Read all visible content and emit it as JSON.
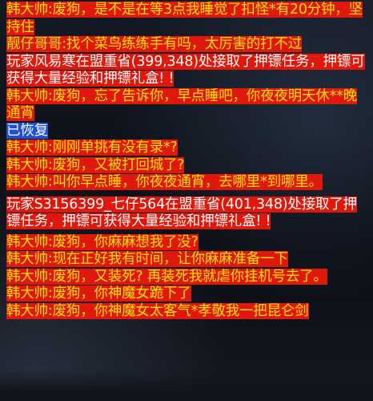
{
  "chat": {
    "messages": [
      {
        "kind": "npc",
        "text": "韩大帅:废狗，是不是在等3点我睡觉了扣怪*有20分钟，坚持住"
      },
      {
        "kind": "npc",
        "text": "靓仔哥哥:找个菜鸟练练手有吗，太厉害的打不过"
      },
      {
        "kind": "system",
        "text": "玩家风易寒在盟重省(399,348)处接取了押镖任务，押镖可获得大量经验和押镖礼盒! !"
      },
      {
        "kind": "npc",
        "text": "韩大帅:废狗，忘了告诉你，早点睡吧，你夜夜明天休**晚通宵"
      },
      {
        "kind": "status",
        "text": "已恢复"
      },
      {
        "kind": "npc",
        "text": "韩大帅:刚刚单挑有没有录*?"
      },
      {
        "kind": "npc",
        "text": "韩大帅:废狗，又被打回城了?"
      },
      {
        "kind": "npc",
        "text": "韩大帅:叫你早点睡，你夜夜通宵，去哪里*到哪里。"
      },
      {
        "kind": "system",
        "text": "玩家S3156399_七仔564在盟重省(401,348)处接取了押镖任务，押镖可获得大量经验和押镖礼盒! !"
      },
      {
        "kind": "npc",
        "text": "韩大帅:废狗，你麻麻想我了没?"
      },
      {
        "kind": "npc",
        "text": "韩大帅:现在正好我有时间，让你麻麻准备一下"
      },
      {
        "kind": "npc",
        "text": "韩大帅:废狗，又装死? 再装死我就虐你挂机号去了。"
      },
      {
        "kind": "npc",
        "text": "韩大帅:废狗，你神魔女跪下了"
      },
      {
        "kind": "npc",
        "text": "韩大帅:废狗，你神魔女太客气*孝敬我一把昆仑剑"
      }
    ]
  }
}
